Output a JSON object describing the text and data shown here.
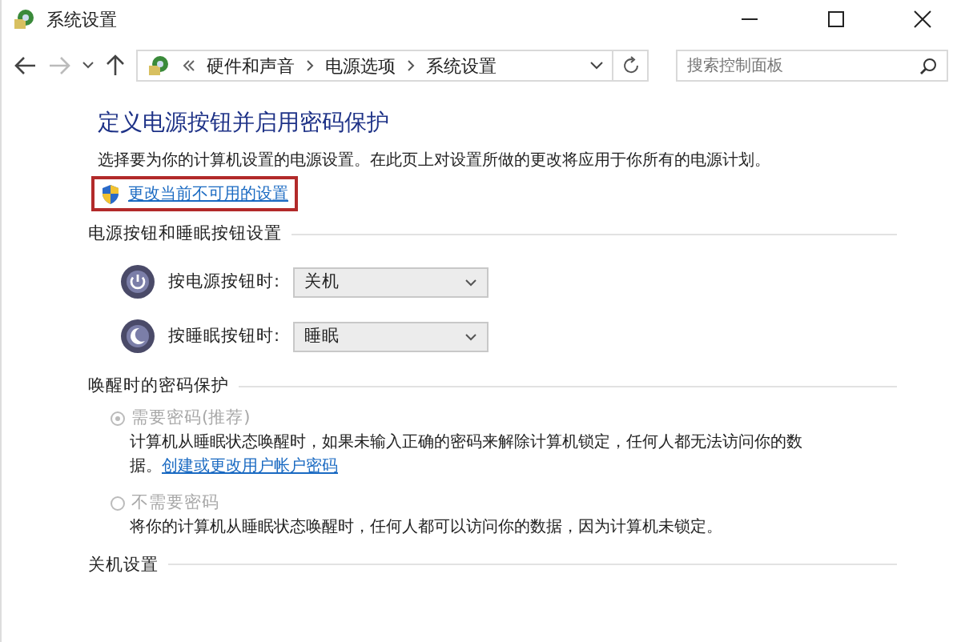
{
  "window": {
    "title": "系统设置"
  },
  "nav": {
    "breadcrumb": [
      "硬件和声音",
      "电源选项",
      "系统设置"
    ],
    "search": {
      "placeholder": "搜索控制面板"
    }
  },
  "page": {
    "heading": "定义电源按钮并启用密码保护",
    "description": "选择要为你的计算机设置的电源设置。在此页上对设置所做的更改将应用于你所有的电源计划。",
    "admin_link": {
      "text": "更改当前不可用的设置",
      "highlighted": true
    }
  },
  "sections": [
    {
      "title": "电源按钮和睡眠按钮设置",
      "kind": "buttons",
      "rows": [
        {
          "kind": "power",
          "label": "按电源按钮时:",
          "value": "关机"
        },
        {
          "kind": "sleep",
          "label": "按睡眠按钮时:",
          "value": "睡眠"
        }
      ]
    },
    {
      "title": "唤醒时的密码保护",
      "kind": "password",
      "options": [
        {
          "label": "需要密码(推荐)",
          "selected": true,
          "disabled": true,
          "description": "计算机从睡眠状态唤醒时，如果未输入正确的密码来解除计算机锁定，任何人都无法访问你的数据。",
          "link": "创建或更改用户帐户密码"
        },
        {
          "label": "不需要密码",
          "selected": false,
          "disabled": true,
          "description": "将你的计算机从睡眠状态唤醒时，任何人都可以访问你的数据，因为计算机未锁定。"
        }
      ]
    },
    {
      "title": "关机设置",
      "kind": "empty"
    }
  ]
}
